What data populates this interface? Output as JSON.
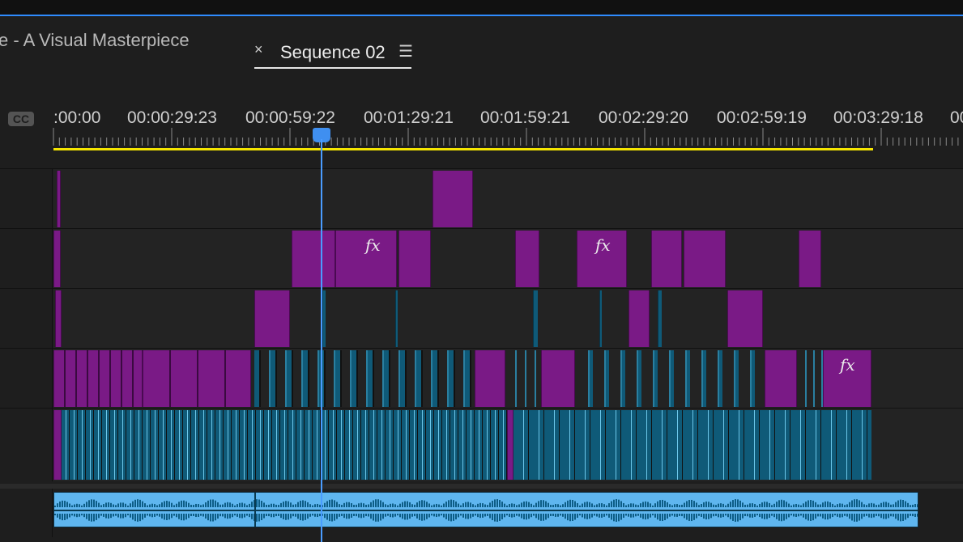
{
  "tabs": {
    "left_tab_title": "e - A Visual Masterpiece",
    "active": {
      "close_glyph": "×",
      "title": "Sequence 02",
      "menu_glyph": "☰"
    }
  },
  "timeline": {
    "cc_label": "CC",
    "timecodes": [
      ":00:00",
      "00:00:29:23",
      "00:00:59:22",
      "00:01:29:21",
      "00:01:59:21",
      "00:02:29:20",
      "00:02:59:19",
      "00:03:29:18",
      "00"
    ],
    "fx_label": "fx"
  },
  "colors": {
    "accent": "#2f8cff",
    "work_area": "#f5e500",
    "video_clip": "#7a1a86",
    "blue_clip": "#0f5a78",
    "audio_clip": "#5fb6ef"
  },
  "icons": {
    "close": "close-icon",
    "menu": "hamburger-menu-icon",
    "cc": "closed-captions-icon",
    "playhead": "playhead-icon"
  }
}
